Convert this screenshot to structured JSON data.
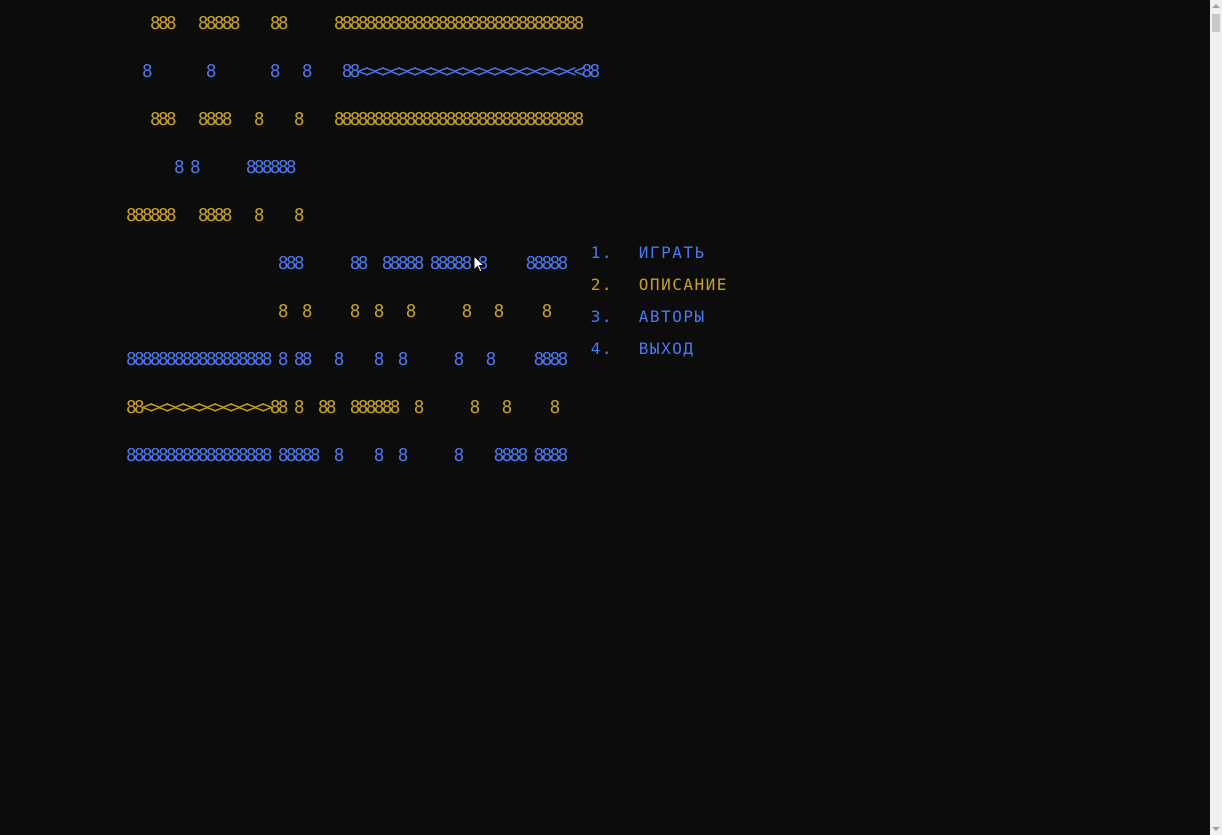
{
  "colors": {
    "background": "#0c0c0c",
    "gold": "#c8a020",
    "blue": "#4a78f0"
  },
  "logo": {
    "lines": [
      [
        [
          "   888   88888    88      ",
          "gold"
        ],
        [
          "8888888888888888888888888888888",
          "gold"
        ]
      ],
      [
        [
          "  8       8       8   8    ",
          "blue"
        ],
        [
          "88<><><><><><><><><><><><><><<88",
          "blue"
        ]
      ],
      [
        [
          "   888   8888   8    8    ",
          "gold"
        ],
        [
          "8888888888888888888888888888888",
          "gold"
        ]
      ],
      [
        [
          "      8 8      888888",
          "blue"
        ]
      ],
      [
        [
          "888888   8888   8    8",
          "gold"
        ]
      ],
      [
        [
          "                   888      88  88888 88888 8     88888",
          "blue"
        ]
      ],
      [
        [
          "                   8  8     8  8   8      8   8     8",
          "gold"
        ]
      ],
      [
        [
          "888888888888888888 8 88   8    8  8      8   8     8888",
          "blue"
        ]
      ],
      [
        [
          "88<><><><><><><><>88",
          "gold"
        ],
        [
          " 8  88  888888  8      8   8     8",
          "gold"
        ]
      ],
      [
        [
          "888888888888888888 88888  8    8  8      8    8888 8888",
          "blue"
        ]
      ]
    ]
  },
  "menu": {
    "items": [
      {
        "number": "1.",
        "label": "ИГРАТЬ",
        "color": "blue"
      },
      {
        "number": "2.",
        "label": "ОПИСАНИЕ",
        "color": "gold"
      },
      {
        "number": "3.",
        "label": "АВТОРЫ",
        "color": "blue"
      },
      {
        "number": "4.",
        "label": "ВЫХОД",
        "color": "blue"
      }
    ]
  },
  "icons": {
    "cursor": "mouse-pointer-icon"
  }
}
